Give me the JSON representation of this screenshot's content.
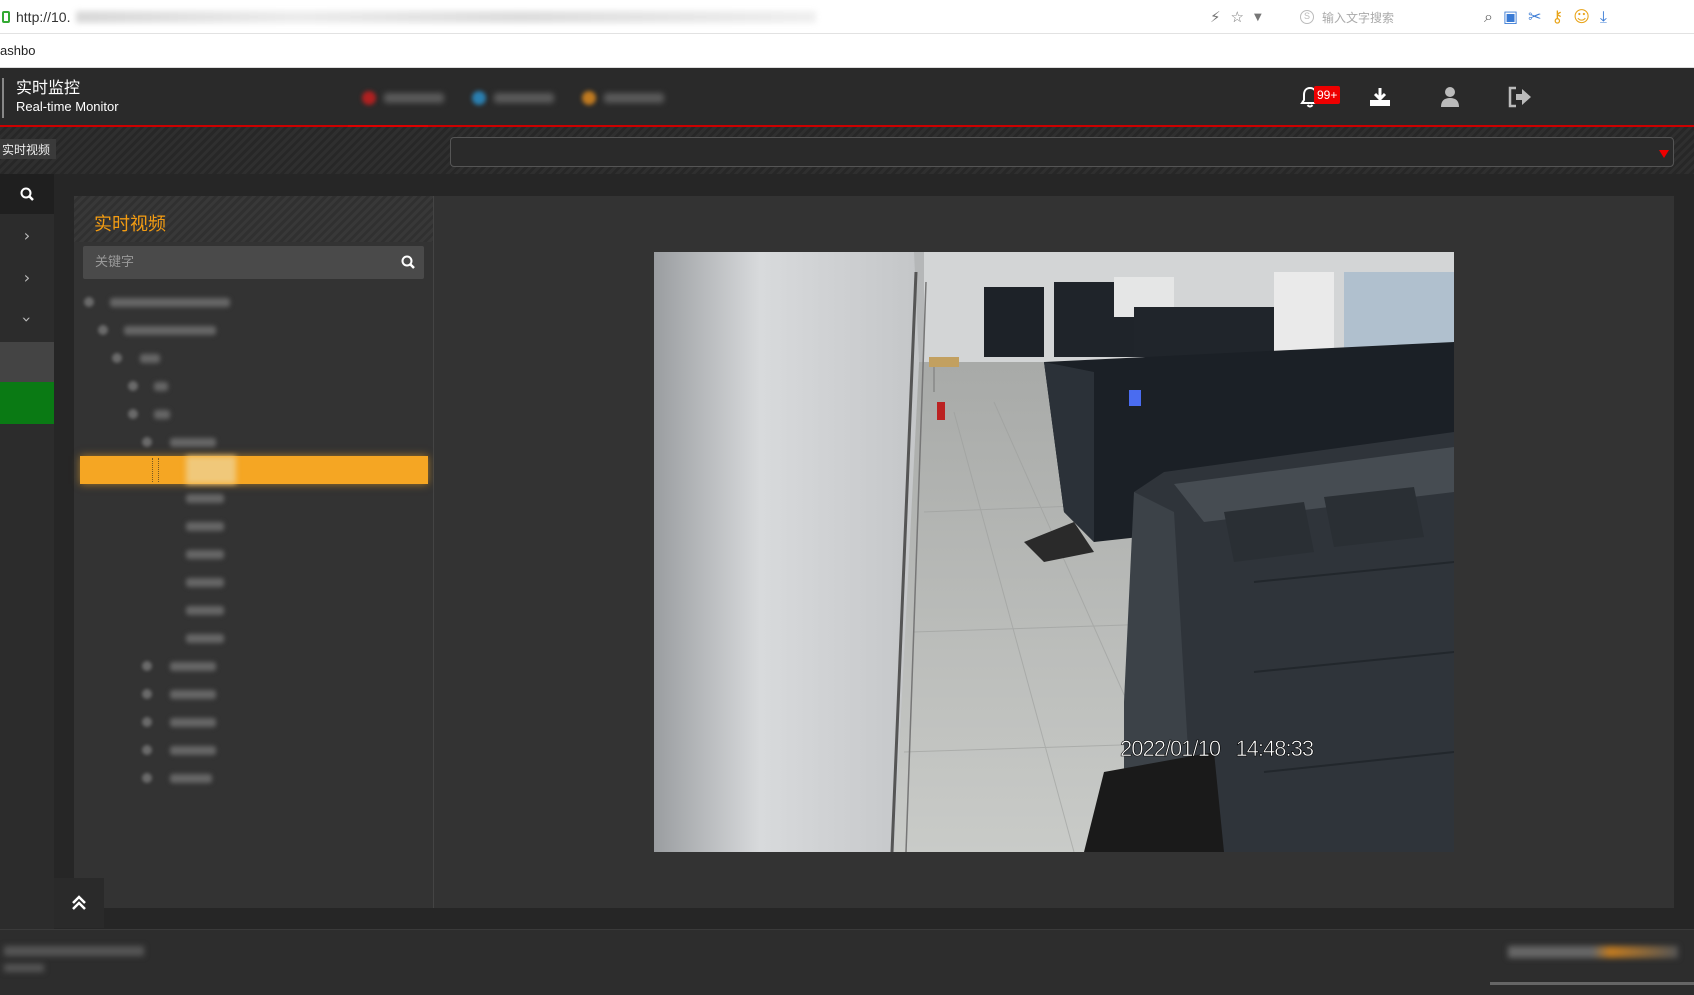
{
  "browser": {
    "url_prefix": "http://10.",
    "search_placeholder": "输入文字搜索",
    "bookmark": "ashbo"
  },
  "header": {
    "title_cn": "实时监控",
    "title_en": "Real-time Monitor",
    "notification_count": "99+",
    "icons": [
      "bell-icon",
      "download-icon",
      "user-icon",
      "logout-icon"
    ]
  },
  "breadcrumb": {
    "label": "实时视频"
  },
  "panel": {
    "title": "实时视频",
    "search_placeholder": "关键字"
  },
  "video": {
    "timestamp": "2022/01/10   14:48:33"
  },
  "colors": {
    "accent": "#f39c12",
    "selection": "#f5a623",
    "alert": "#ee0000",
    "active_green": "#0a7a14"
  }
}
